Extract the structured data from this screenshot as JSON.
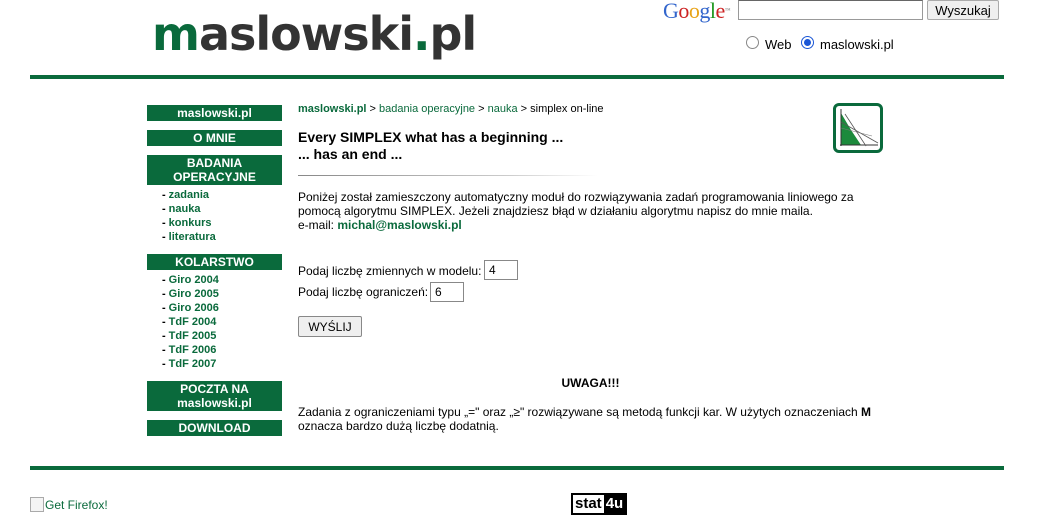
{
  "header": {
    "logo": {
      "m": "m",
      "rest": "aslowski",
      "dot": ".",
      "tld": "pl"
    },
    "google": {
      "letters": [
        {
          "ch": "G",
          "color": "#3366cc"
        },
        {
          "ch": "o",
          "color": "#cc2222"
        },
        {
          "ch": "o",
          "color": "#e8a317"
        },
        {
          "ch": "g",
          "color": "#3366cc"
        },
        {
          "ch": "l",
          "color": "#229922"
        },
        {
          "ch": "e",
          "color": "#cc2222"
        }
      ],
      "tm": "™"
    },
    "search": {
      "value": "",
      "button_label": "Wyszukaj"
    },
    "radio_options": [
      {
        "label": "Web",
        "selected": false
      },
      {
        "label": "maslowski.pl",
        "selected": true
      }
    ]
  },
  "sidebar": {
    "home": "maslowski.pl",
    "about": "O MNIE",
    "badania": {
      "title": "BADANIA OPERACYJNE",
      "items": [
        "zadania",
        "nauka",
        "konkurs",
        "literatura"
      ]
    },
    "kolarstwo": {
      "title": "KOLARSTWO",
      "items": [
        "Giro 2004",
        "Giro 2005",
        "Giro 2006",
        "TdF 2004",
        "TdF 2005",
        "TdF 2006",
        "TdF 2007"
      ]
    },
    "mail": "POCZTA NA maslowski.pl",
    "download": "DOWNLOAD",
    "dash": "-"
  },
  "main": {
    "breadcrumb": {
      "home": "maslowski.pl",
      "sep": " > ",
      "section": "badania operacyjne",
      "sub": "nauka",
      "current": "simplex on-line"
    },
    "headline1": "Every SIMPLEX what has a beginning ...",
    "headline2": "... has an end ...",
    "intro": "Poniżej został zamieszczony automatyczny moduł do rozwiązywania zadań programowania liniowego za pomocą algorytmu SIMPLEX. Jeżeli znajdziesz błąd w działaniu algorytmu napisz do mnie maila.",
    "email_label": "e-mail: ",
    "email": "michal@maslowski.pl",
    "form": {
      "vars_label": "Podaj liczbę zmiennych w modelu:",
      "vars_value": "4",
      "cons_label": "Podaj liczbę ograniczeń:",
      "cons_value": "6",
      "submit_label": "WYŚLIJ"
    },
    "warning_title": "UWAGA!!!",
    "warning_text_a": "Zadania z ograniczeniami typu „=\" oraz „≥\" rozwiązywane są metodą funkcji kar. W użytych oznaczeniach ",
    "warning_M": "M",
    "warning_text_b": " oznacza bardzo dużą liczbę dodatnią."
  },
  "footer": {
    "firefox": "Get Firefox!",
    "stat1": "stat",
    "stat2": "4u"
  },
  "colors": {
    "brand_green": "#0a6a3c"
  }
}
